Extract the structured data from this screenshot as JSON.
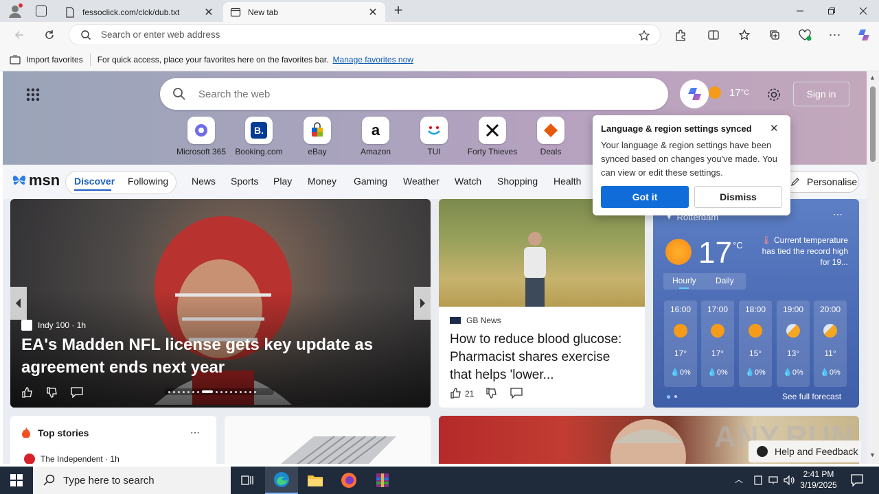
{
  "browser": {
    "tabs": [
      {
        "label": "fessoclick.com/clck/dub.txt"
      },
      {
        "label": "New tab"
      }
    ],
    "address_placeholder": "Search or enter web address"
  },
  "favorites_bar": {
    "import_label": "Import favorites",
    "hint": "For quick access, place your favorites here on the favorites bar.",
    "manage_link": "Manage favorites now"
  },
  "newtab": {
    "search_placeholder": "Search the web",
    "weather_temp": "17",
    "weather_unit": "°C",
    "signin_label": "Sign in",
    "quick_links": [
      {
        "label": "Microsoft 365",
        "icon": "m365-icon"
      },
      {
        "label": "Booking.com",
        "icon": "booking-icon"
      },
      {
        "label": "eBay",
        "icon": "ebay-icon"
      },
      {
        "label": "Amazon",
        "icon": "amazon-icon"
      },
      {
        "label": "TUI",
        "icon": "tui-icon"
      },
      {
        "label": "Forty Thieves",
        "icon": "forty-thieves-icon"
      },
      {
        "label": "Deals",
        "icon": "deals-icon"
      }
    ]
  },
  "msn_nav": {
    "logo": "msn",
    "discover": "Discover",
    "following": "Following",
    "links": [
      "News",
      "Sports",
      "Play",
      "Money",
      "Gaming",
      "Weather",
      "Watch",
      "Shopping",
      "Health"
    ],
    "personalise": "Personalise"
  },
  "popup": {
    "title": "Language & region settings synced",
    "body": "Your language & region settings have been synced based on changes you've made. You can view or edit these settings.",
    "primary": "Got it",
    "secondary": "Dismiss"
  },
  "feature_story": {
    "source": "Indy 100",
    "age": "1h",
    "headline": "EA's Madden NFL license gets key update as agreement ends next year"
  },
  "news_story": {
    "source": "GB News",
    "headline": "How to reduce blood glucose: Pharmacist shares exercise that helps 'lower...",
    "likes": "21"
  },
  "weather": {
    "location": "Rotterdam",
    "temp": "17",
    "unit": "°C",
    "alert": "Current temperature has tied the record high for 19...",
    "tab_hourly": "Hourly",
    "tab_daily": "Daily",
    "hours": [
      {
        "time": "16:00",
        "temp": "17°",
        "precip": "0%",
        "icon": "sun-icon"
      },
      {
        "time": "17:00",
        "temp": "17°",
        "precip": "0%",
        "icon": "sun-icon"
      },
      {
        "time": "18:00",
        "temp": "15°",
        "precip": "0%",
        "icon": "sun-icon"
      },
      {
        "time": "19:00",
        "temp": "13°",
        "precip": "0%",
        "icon": "partly-cloudy-icon"
      },
      {
        "time": "20:00",
        "temp": "11°",
        "precip": "0%",
        "icon": "partly-cloudy-icon"
      }
    ],
    "forecast_link": "See full forecast"
  },
  "top_stories": {
    "title": "Top stories",
    "first_source": "The Independent",
    "first_age": "1h"
  },
  "help_label": "Help and Feedback",
  "watermark": "ANY.RUN",
  "taskbar": {
    "search_placeholder": "Type here to search",
    "time": "2:41 PM",
    "date": "3/19/2025"
  },
  "colors": {
    "accent": "#0f6cd9",
    "msn_blue": "#1d5fbf",
    "weather_bg": "#4a6ab3"
  }
}
